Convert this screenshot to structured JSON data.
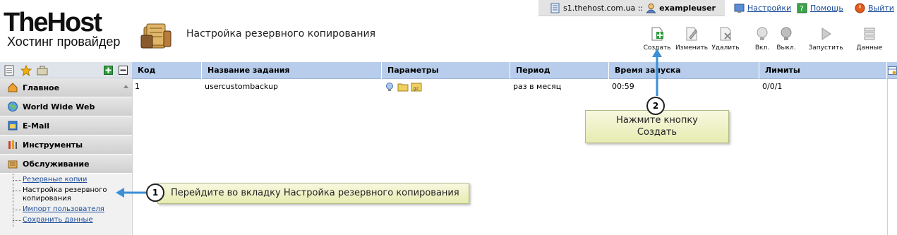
{
  "brand": {
    "name": "TheHost",
    "tagline": "Хостинг провайдер"
  },
  "page": {
    "title": "Настройка резервного копирования"
  },
  "topbar": {
    "server": "s1.thehost.com.ua ::",
    "user": "exampleuser",
    "links": {
      "settings": "Настройки",
      "help": "Помощь",
      "logout": "Выйти"
    }
  },
  "toolbar": {
    "create": "Создать",
    "edit": "Изменить",
    "delete": "Удалить",
    "enable": "Вкл.",
    "disable": "Выкл.",
    "run": "Запустить",
    "data": "Данные"
  },
  "sidebar": {
    "sections": [
      {
        "label": "Главное",
        "icon": "home-icon"
      },
      {
        "label": "World Wide Web",
        "icon": "globe-icon"
      },
      {
        "label": "E-Mail",
        "icon": "mail-icon"
      },
      {
        "label": "Инструменты",
        "icon": "tools-icon"
      },
      {
        "label": "Обслуживание",
        "icon": "maintenance-icon"
      }
    ],
    "subitems": [
      {
        "label": "Резервные копии"
      },
      {
        "label": "Настройка резервного копирования"
      },
      {
        "label": "Импорт пользователя"
      },
      {
        "label": "Сохранить данные"
      }
    ]
  },
  "table": {
    "columns": [
      "Код",
      "Название задания",
      "Параметры",
      "Период",
      "Время запуска",
      "Лимиты"
    ],
    "rows": [
      {
        "code": "1",
        "name": "usercustombackup",
        "period": "раз в месяц",
        "time": "00:59",
        "limits": "0/0/1"
      }
    ]
  },
  "callouts": {
    "step1": {
      "num": "1",
      "text": "Перейдите во вкладку Настройка резервного копирования"
    },
    "step2": {
      "num": "2",
      "text": "Нажмите кнопку Создать"
    }
  },
  "colors": {
    "table_header": "#b7cdeb",
    "link": "#1a4b9a",
    "callout_bg": "#eef2c6",
    "arrow": "#3a8fd6"
  }
}
